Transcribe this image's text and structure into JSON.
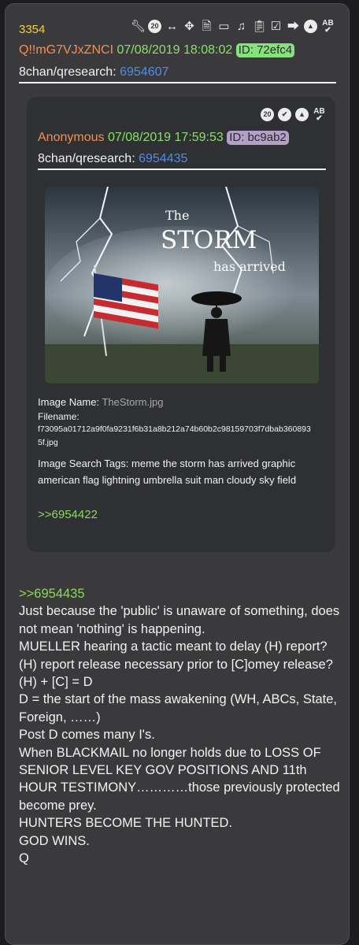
{
  "post": {
    "number": "3354",
    "tripcode": "Q!!mG7VJxZNCI",
    "datetime": "07/08/2019 18:08:02",
    "id_badge": "ID: 72efc4",
    "board": "8chan/qresearch:",
    "post_link": "6954607"
  },
  "toolbar_icons": [
    "wrench-icon",
    "timer-20-icon",
    "horizontal-arrows-icon",
    "move-icon",
    "document-icon",
    "vr-headset-icon",
    "music-note-icon",
    "clipboard-icon",
    "clipboard-check-icon",
    "share-icon",
    "up-arrow-circle-icon",
    "translate-ab-icon"
  ],
  "quoted": {
    "toolbar_icons": [
      "timer-20-icon",
      "check-circle-icon",
      "up-arrow-circle-icon",
      "translate-ab-icon"
    ],
    "author": "Anonymous",
    "datetime": "07/08/2019 17:59:53",
    "id_badge": "ID: bc9ab2",
    "board": "8chan/qresearch:",
    "post_link": "6954435",
    "image_caption": {
      "the": "The",
      "storm": "STORM",
      "has_arrived": "has arrived"
    },
    "image_name_label": "Image Name:",
    "image_name": "TheStorm.jpg",
    "filename_label": "Filename:",
    "filename_line1": "f73095a01712a9f0fa9231f6b31a8b212a74b60b2c98159703f7dbab360893",
    "filename_line2": "5f.jpg",
    "tags_label": "Image Search Tags:",
    "tags": "meme the storm has arrived graphic american flag lightning umbrella suit man cloudy sky field",
    "reply_link": ">>6954422"
  },
  "body": {
    "reply_link": ">>6954435",
    "lines": [
      "Just because the 'public' is unaware of something, does not mean 'nothing' is happening.",
      "MUELLER hearing a tactic meant to delay (H) report?",
      "(H) report release necessary prior to [C]omey release?",
      "(H) + [C] = D",
      "D = the start of the mass awakening (WH, ABCs, State, Foreign, ……)",
      "Post D comes many I's.",
      "When BLACKMAIL no longer holds due to LOSS OF SENIOR LEVEL KEY GOV POSITIONS AND 11th HOUR TESTIMONY…………those previously protected become prey.",
      "HUNTERS BECOME THE HUNTED.",
      "GOD WINS.",
      "Q"
    ]
  },
  "colors": {
    "post_number": "#f5d03d",
    "tripcode": "#f28f56",
    "date": "#8be06a",
    "link": "#4c8cf0",
    "greentext": "#8fd65e",
    "card_bg": "#3a3a3c",
    "quote_bg": "#2f3033"
  }
}
